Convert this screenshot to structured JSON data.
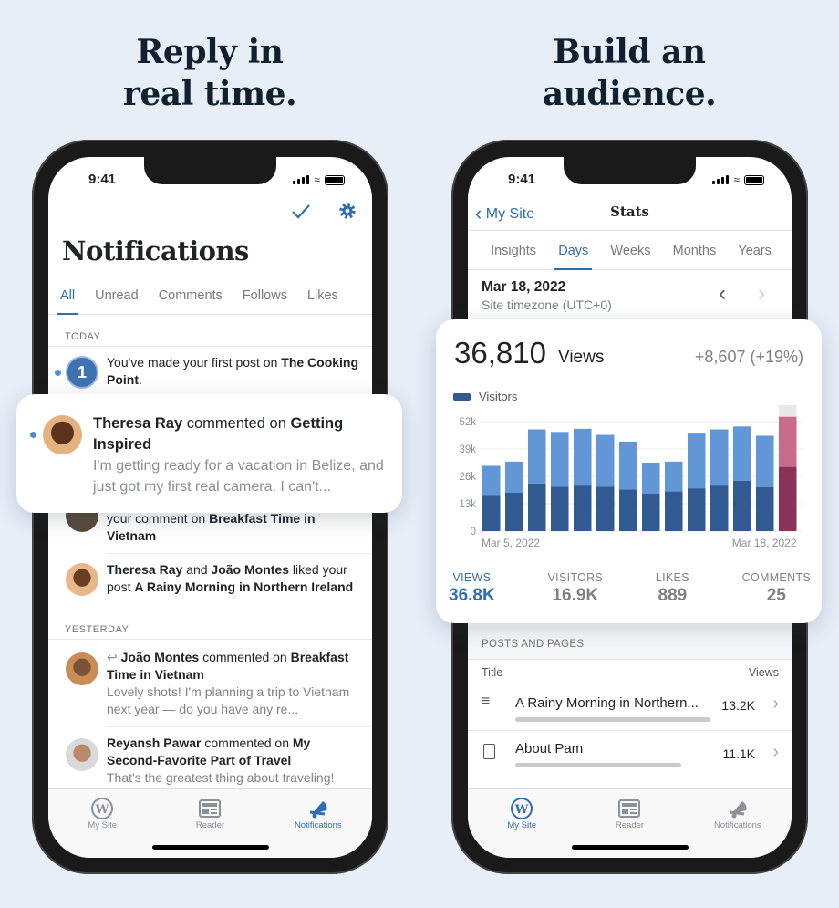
{
  "headlines": {
    "left": "Reply in\nreal time.",
    "right": "Build an\naudience."
  },
  "status": {
    "time": "9:41"
  },
  "colors": {
    "accent": "#2f6db3",
    "visitors": "#305a91",
    "views": "#6197d6",
    "today_views": "#c96c8c",
    "today_visitors": "#8d3257",
    "background": "#e7eef8"
  },
  "notifications": {
    "title": "Notifications",
    "icons": [
      "checkmark-icon",
      "gear-icon"
    ],
    "tabs": [
      "All",
      "Unread",
      "Comments",
      "Follows",
      "Likes"
    ],
    "active_tab": "All",
    "today_label": "TODAY",
    "yesterday_label": "YESTERDAY",
    "items": [
      {
        "pre": "You've made your first post on ",
        "bold": "The Cooking Point",
        "post": ".",
        "unread": true
      },
      {
        "actor": "Theresa Ray",
        "mid": " commented on ",
        "target": "Getting Inspired",
        "excerpt": "I'm getting ready for a vacation in Belize, and just got my first real camera. I can't...",
        "unread": true
      },
      {
        "pre": "your comment on ",
        "bold": "Breakfast Time in Vietnam"
      },
      {
        "actor": "Theresa Ray",
        "and": " and ",
        "actor2": "João Montes",
        "mid": " liked your post ",
        "target": "A Rainy Morning in Northern Ireland"
      },
      {
        "actor": "João Montes",
        "mid": " commented on ",
        "target": "Breakfast Time in Vietnam",
        "excerpt": "Lovely shots! I'm planning a trip to Vietnam next year — do you have any re..."
      },
      {
        "actor": "Reyansh Pawar",
        "mid": " commented on ",
        "target": "My Second-Favorite Part of Travel",
        "excerpt": "That's the greatest thing about traveling!"
      }
    ]
  },
  "tabbar": {
    "items": [
      "My Site",
      "Reader",
      "Notifications"
    ]
  },
  "stats": {
    "back_label": "My Site",
    "title": "Stats",
    "tabs": [
      "Insights",
      "Days",
      "Weeks",
      "Months",
      "Years"
    ],
    "active_tab": "Days",
    "date": "Mar 18, 2022",
    "timezone": "Site timezone (UTC+0)",
    "views_value": "36,810",
    "views_label": "Views",
    "change": "+8,607 (+19%)",
    "summary": [
      {
        "label": "VIEWS",
        "value": "36.8K",
        "active": true
      },
      {
        "label": "VISITORS",
        "value": "16.9K"
      },
      {
        "label": "LIKES",
        "value": "889"
      },
      {
        "label": "COMMENTS",
        "value": "25"
      }
    ],
    "posts_header": "POSTS AND PAGES",
    "col_title": "Title",
    "col_views": "Views",
    "posts": [
      {
        "title": "A Rainy Morning in Northern...",
        "views": "13.2K",
        "share": 1.0,
        "icon": "post-lines-icon"
      },
      {
        "title": "About Pam",
        "views": "11.1K",
        "share": 0.84,
        "icon": "page-icon"
      }
    ]
  },
  "chart_data": {
    "type": "bar",
    "stacked": true,
    "legend": [
      "Visitors"
    ],
    "legend_placement": "top-left",
    "yticks": [
      "0",
      "13k",
      "26k",
      "39k",
      "52k"
    ],
    "ylim": [
      0,
      60
    ],
    "xlabels": {
      "first": "Mar 5, 2022",
      "last": "Mar 18, 2022"
    },
    "grid": true,
    "categories": [
      "Mar 5",
      "Mar 6",
      "Mar 7",
      "Mar 8",
      "Mar 9",
      "Mar 10",
      "Mar 11",
      "Mar 12",
      "Mar 13",
      "Mar 14",
      "Mar 15",
      "Mar 16",
      "Mar 17",
      "Mar 18"
    ],
    "series": [
      {
        "name": "Visitors",
        "values": [
          17.2,
          18.2,
          22.6,
          21.1,
          21.6,
          21.1,
          19.7,
          17.8,
          18.8,
          20.3,
          21.6,
          23.9,
          20.8,
          30.5
        ]
      },
      {
        "values": [
          31,
          33,
          48.3,
          47.1,
          48.6,
          45.7,
          42.5,
          32.5,
          33,
          46.3,
          48.3,
          49.7,
          45.3,
          54.3
        ]
      }
    ],
    "selected": "Mar 18",
    "max_today": 59.8
  }
}
